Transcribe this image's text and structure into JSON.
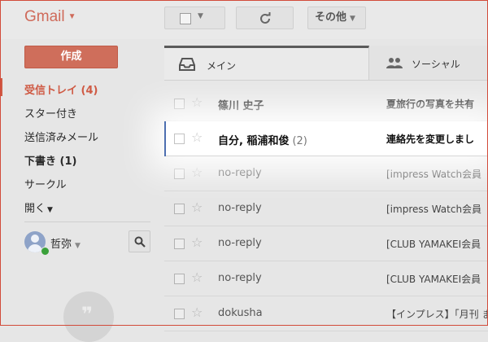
{
  "app": {
    "logo": "Gmail"
  },
  "toolbar": {
    "more_label": "その他"
  },
  "nav": {
    "compose": "作成",
    "inbox": "受信トレイ (4)",
    "starred": "スター付き",
    "sent": "送信済みメール",
    "drafts": "下書き (1)",
    "circles": "サークル",
    "more": "開く"
  },
  "account": {
    "name": "哲弥"
  },
  "tabs": [
    {
      "label": "メイン",
      "icon": "inbox-icon"
    },
    {
      "label": "ソーシャル",
      "icon": "people-icon"
    }
  ],
  "messages": [
    {
      "sender": "篠川 史子",
      "count": "",
      "subject": "夏旅行の写真を共有",
      "unread": true
    },
    {
      "sender": "自分, 稲浦和俊",
      "count": "(2)",
      "subject": "連絡先を変更しまし",
      "unread": true
    },
    {
      "sender": "no-reply",
      "count": "",
      "subject": "[impress Watch会員",
      "unread": false
    },
    {
      "sender": "no-reply",
      "count": "",
      "subject": "[impress Watch会員",
      "unread": false
    },
    {
      "sender": "no-reply",
      "count": "",
      "subject": "[CLUB YAMAKEI会員",
      "unread": false
    },
    {
      "sender": "no-reply",
      "count": "",
      "subject": "[CLUB YAMAKEI会員",
      "unread": false
    },
    {
      "sender": "dokusha",
      "count": "",
      "subject": "【インプレス】「月刊 ま",
      "unread": false
    }
  ],
  "colors": {
    "accent": "#cf5a44",
    "compose": "#cf6e5b",
    "highlight_bar": "#4d6fb0"
  }
}
